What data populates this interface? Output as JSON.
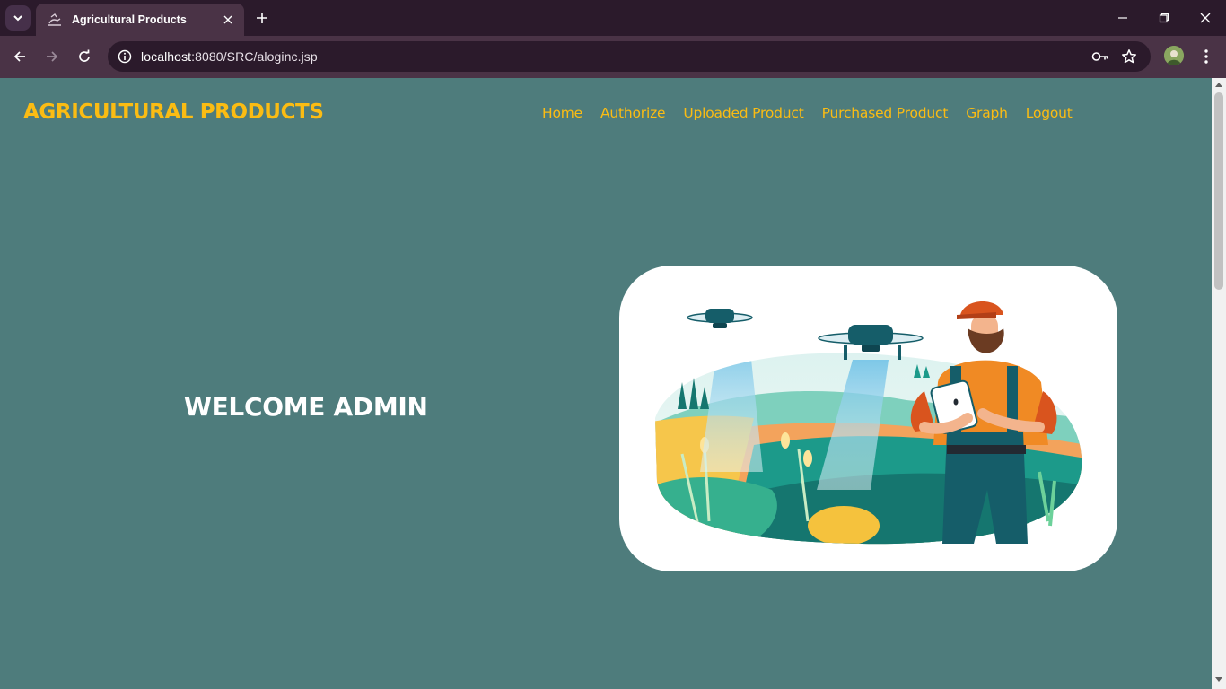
{
  "browser": {
    "tab_title": "Agricultural Products",
    "url_host": "localhost",
    "url_rest": ":8080/SRC/aloginc.jsp",
    "icons": {
      "tab_search": "chevron-down-icon",
      "tab_close": "close-icon",
      "new_tab": "plus-icon",
      "minimize": "minimize-icon",
      "restore": "restore-icon",
      "close_window": "close-icon",
      "back": "arrow-left-icon",
      "forward": "arrow-right-icon",
      "reload": "reload-icon",
      "site_info": "info-icon",
      "password": "key-icon",
      "bookmark": "star-icon",
      "menu": "kebab-menu-icon"
    },
    "colors": {
      "tab_strip": "#2b1a2b",
      "toolbar": "#4a3346"
    }
  },
  "page": {
    "brand": "AGRICULTURAL PRODUCTS",
    "nav": [
      "Home",
      "Authorize",
      "Uploaded Product",
      "Purchased Product",
      "Graph",
      "Logout"
    ],
    "welcome": "WELCOME ADMIN",
    "colors": {
      "background": "#4e7c7c",
      "accent": "#fbbc13",
      "heading": "#ffffff",
      "card": "#ffffff"
    }
  }
}
